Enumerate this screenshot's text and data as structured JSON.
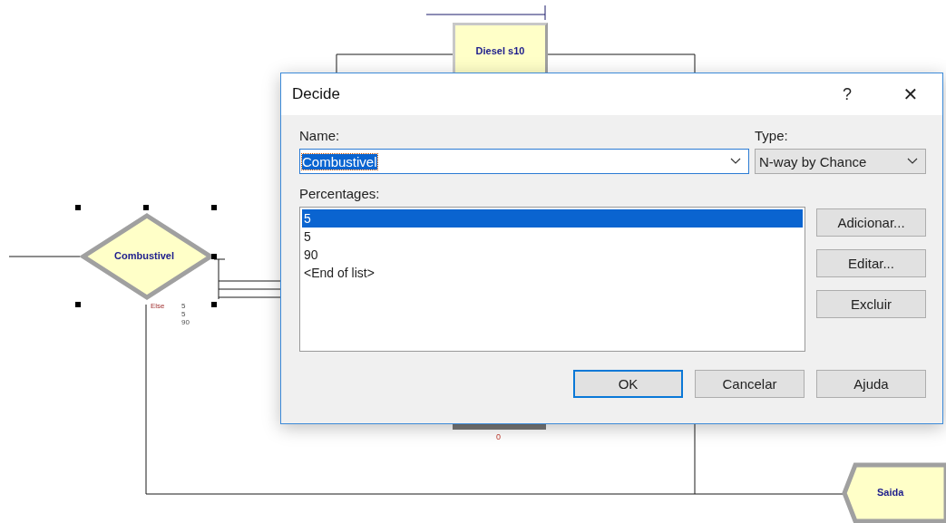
{
  "canvas": {
    "nodes": [
      {
        "kind": "process",
        "label": "Diesel s10"
      },
      {
        "kind": "decide",
        "label": "Combustivel",
        "selected": true,
        "else_label": "Else",
        "branch_labels": [
          "5",
          "5",
          "90"
        ]
      },
      {
        "kind": "counter",
        "label": "0"
      },
      {
        "kind": "dispose",
        "label": "Saida"
      }
    ]
  },
  "dialog": {
    "title": "Decide",
    "help": "?",
    "close": "✕",
    "name_label": "Name:",
    "name_value": "Combustivel",
    "name_text_selected": true,
    "type_label": "Type:",
    "type_value": "N-way by Chance",
    "list_label": "Percentages:",
    "list_items": [
      {
        "text": "5",
        "selected": true
      },
      {
        "text": "5",
        "selected": false
      },
      {
        "text": "90",
        "selected": false
      },
      {
        "text": "<End of list>",
        "selected": false
      }
    ],
    "side_buttons": [
      "Adicionar...",
      "Editar...",
      "Excluir"
    ],
    "buttons": [
      {
        "label": "OK",
        "default": true
      },
      {
        "label": "Cancelar",
        "default": false
      },
      {
        "label": "Ajuda",
        "default": false
      }
    ]
  }
}
